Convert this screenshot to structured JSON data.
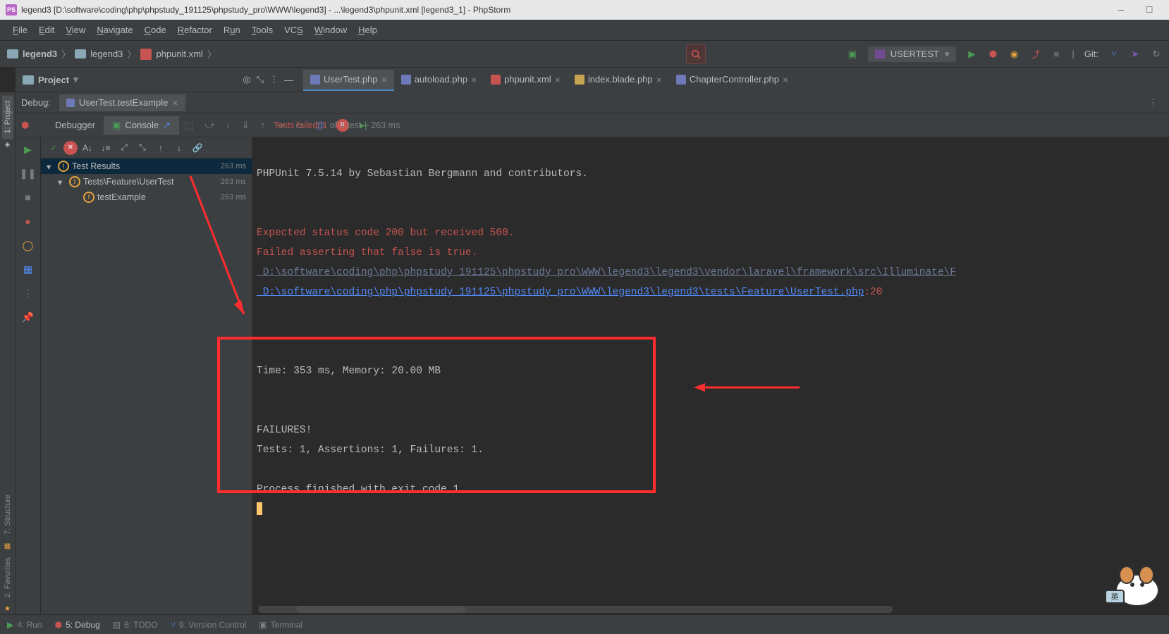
{
  "titlebar": {
    "text": "legend3 [D:\\software\\coding\\php\\phpstudy_191125\\phpstudy_pro\\WWW\\legend3] - ...\\legend3\\phpunit.xml [legend3_1] - PhpStorm",
    "icon": "PS"
  },
  "menubar": [
    "File",
    "Edit",
    "View",
    "Navigate",
    "Code",
    "Refactor",
    "Run",
    "Tools",
    "VCS",
    "Window",
    "Help"
  ],
  "breadcrumb": {
    "items": [
      "legend3",
      "legend3",
      "phpunit.xml"
    ]
  },
  "run_config": {
    "name": "USERTEST"
  },
  "git_label": "Git:",
  "project_label": "Project",
  "editor_tabs": [
    {
      "label": "UserTest.php",
      "type": "php",
      "active": true
    },
    {
      "label": "autoload.php",
      "type": "php",
      "active": false
    },
    {
      "label": "phpunit.xml",
      "type": "xml",
      "active": false
    },
    {
      "label": "index.blade.php",
      "type": "blade",
      "active": false
    },
    {
      "label": "ChapterController.php",
      "type": "php",
      "active": false
    }
  ],
  "left_gutter": {
    "project": "1: Project",
    "structure": "7: Structure",
    "favorites": "2: Favorites"
  },
  "debug": {
    "header_label": "Debug:",
    "run_tab": "UserTest.testExample",
    "tabs": {
      "debugger": "Debugger",
      "console": "Console"
    },
    "tests_status": {
      "failed_label": "Tests failed:",
      "failed_count": "1",
      "of_total": "of 1 test",
      "dash_time": "– 263 ms"
    },
    "tree": [
      {
        "label": "Test Results",
        "ms": "263 ms",
        "depth": 0,
        "selected": true
      },
      {
        "label": "Tests\\Feature\\UserTest",
        "ms": "263 ms",
        "depth": 1,
        "selected": false
      },
      {
        "label": "testExample",
        "ms": "263 ms",
        "depth": 2,
        "selected": false
      }
    ]
  },
  "console": {
    "phpunit": "PHPUnit 7.5.14 by Sebastian Bergmann and contributors.",
    "err1": "Expected status code 200 but received 500.",
    "err2": "Failed asserting that false is true.",
    "link_dim": " D:\\software\\coding\\php\\phpstudy_191125\\phpstudy_pro\\WWW\\legend3\\legend3\\vendor\\laravel\\framework\\src\\Illuminate\\F",
    "link2": " D:\\software\\coding\\php\\phpstudy_191125\\phpstudy_pro\\WWW\\legend3\\legend3\\tests\\Feature\\UserTest.php",
    "link2_line": ":20",
    "time_mem": "Time: 353 ms, Memory: 20.00 MB",
    "failures": "FAILURES!",
    "summary": "Tests: 1, Assertions: 1, Failures: 1.",
    "exit": "Process finished with exit code 1"
  },
  "statusbar": {
    "run": "4: Run",
    "debug": "5: Debug",
    "todo": "6: TODO",
    "vcs": "9: Version Control",
    "terminal": "Terminal"
  }
}
